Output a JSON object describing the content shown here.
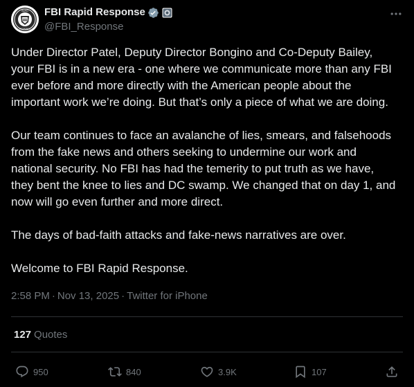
{
  "post": {
    "author": {
      "display_name": "FBI Rapid Response",
      "handle": "@FBI_Response",
      "avatar_icon": "fbi-seal-icon",
      "verified_icon": "gov-verified-badge-icon",
      "affiliate_icon": "affiliate-badge-icon"
    },
    "paragraphs": [
      "Under Director Patel, Deputy Director Bongino and Co-Deputy Bailey,\nyour FBI is in a new era - one where we communicate more than any FBI\never before and more directly with the American people about the\nimportant work we’re doing. But that’s only a piece of what we are doing.",
      "Our team continues to face an avalanche of lies, smears, and falsehoods\nfrom the fake news and others seeking to undermine our work and\nnational security.  No FBI has had the temerity to put truth as we have,\nthey bent the knee to lies and DC swamp. We changed that on day 1, and\nnow will go even further and more direct.",
      "The days of bad-faith attacks and fake-news narratives are over.",
      "Welcome to FBI Rapid Response."
    ],
    "time": "2:58 PM",
    "date": "Nov 13, 2025",
    "source": "Twitter for iPhone",
    "separator": "·",
    "quotes": {
      "count": "127",
      "label": "Quotes"
    },
    "actions": {
      "replies": "950",
      "reposts": "840",
      "likes": "3.9K",
      "bookmarks": "107"
    }
  },
  "colors": {
    "background": "#000000",
    "text_primary": "#e7e9ea",
    "text_secondary": "#71767b",
    "divider": "#2f3336",
    "verified_gray": "#829aab"
  }
}
